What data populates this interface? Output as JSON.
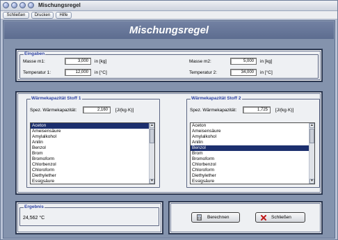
{
  "window": {
    "title": "Mischungsregel"
  },
  "menu": {
    "items": [
      "Schließen",
      "Drucken",
      "Hilfe"
    ]
  },
  "banner": {
    "title": "Mischungsregel"
  },
  "eingaben": {
    "legend": "Eingaben",
    "masse_m1": {
      "label": "Masse m1:",
      "value": "3,000",
      "unit": "in [kg]"
    },
    "temperatur_1": {
      "label": "Temperatur 1:",
      "value": "12,000",
      "unit": "in [°C]"
    },
    "masse_m2": {
      "label": "Masse m2:",
      "value": "5,000",
      "unit": "in [kg]"
    },
    "temperatur_2": {
      "label": "Temperatur 2:",
      "value": "34,000",
      "unit": "in [°C]"
    }
  },
  "stoff1": {
    "legend": "Wärmekapazität Stoff 1",
    "label": "Spez. Wärmekapazität:",
    "value": "2,160",
    "unit": "[J/(kg·K)]",
    "items": [
      "Aceton",
      "Ameisensäure",
      "Amylalkohol",
      "Anilin",
      "Benzol",
      "Brom",
      "Bromoform",
      "Chlorbenzol",
      "Chloroform",
      "Diethylether",
      "Essigsäure"
    ],
    "selected": "Aceton"
  },
  "stoff2": {
    "legend": "Wärmekapazität Stoff 2",
    "label": "Spez. Wärmekapazität:",
    "value": "1,725",
    "unit": "[J/(kg·K)]",
    "items": [
      "Aceton",
      "Ameisensäure",
      "Amylalkohol",
      "Anilin",
      "Benzol",
      "Brom",
      "Bromoform",
      "Chlorbenzol",
      "Chloroform",
      "Diethylether",
      "Essigsäure"
    ],
    "selected": "Benzol"
  },
  "ergebnis": {
    "legend": "Ergebnis",
    "value": "24,562 °C"
  },
  "buttons": {
    "berechnen": "Berechnen",
    "schliessen": "Schließen"
  },
  "colors": {
    "banner": "#6878a0",
    "legend_text": "#2a3fa0",
    "selection": "#1c2f6e"
  }
}
